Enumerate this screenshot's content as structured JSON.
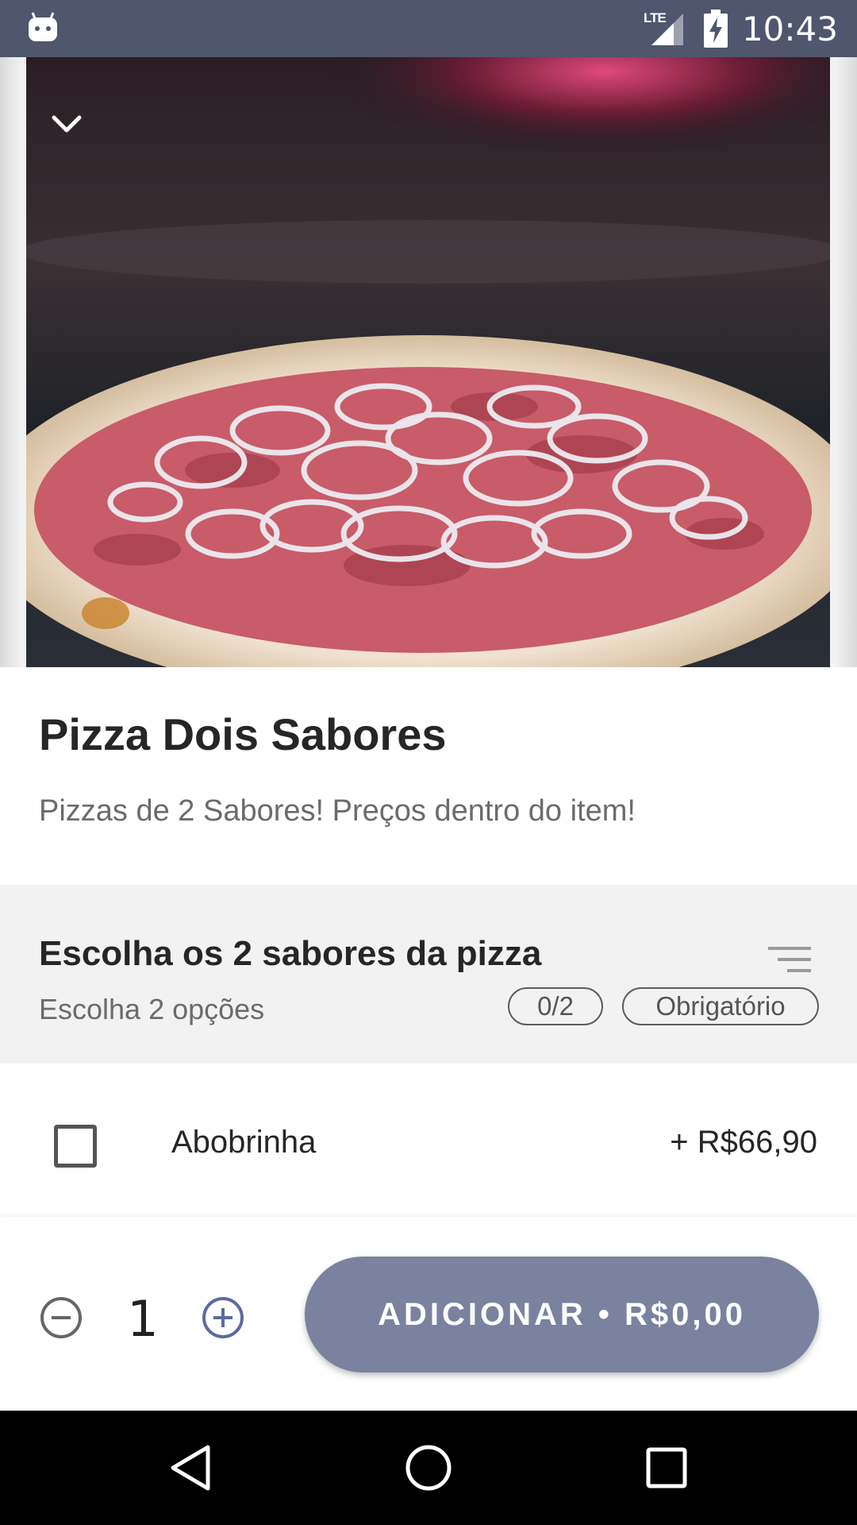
{
  "status_bar": {
    "network": "LTE",
    "time": "10:43",
    "icons": [
      "android-debug-icon",
      "signal-icon",
      "battery-charging-icon"
    ]
  },
  "hero": {
    "collapse_icon": "chevron-down-icon"
  },
  "product": {
    "title": "Pizza Dois Sabores",
    "description": "Pizzas de 2 Sabores! Preços dentro do item!"
  },
  "section": {
    "title": "Escolha os 2 sabores da pizza",
    "subtitle": "Escolha 2 opções",
    "count_badge": "0/2",
    "required_badge": "Obrigatório",
    "sort_icon": "sort-lines-icon"
  },
  "options": [
    {
      "name": "Abobrinha",
      "price": "+ R$66,90",
      "checked": false
    }
  ],
  "bottom_bar": {
    "quantity": "1",
    "add_label": "ADICIONAR • R$0,00",
    "button_color": "#7a829f",
    "accent_color": "#5c6b9e"
  },
  "nav_bar": {
    "icons": [
      "back-icon",
      "home-icon",
      "recents-icon"
    ]
  }
}
